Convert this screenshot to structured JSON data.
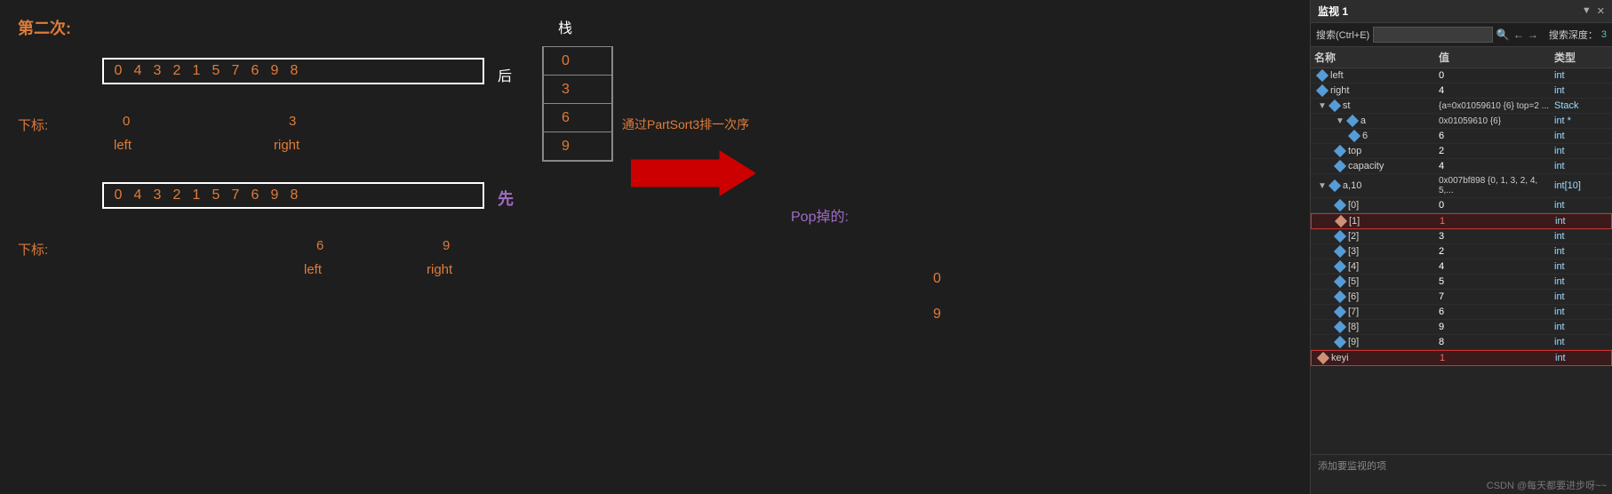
{
  "title": "第二次:",
  "main": {
    "second_label": "第二次:",
    "array_top": [
      "0",
      "4",
      "3",
      "2",
      "1",
      "5",
      "7",
      "6",
      "9",
      "8"
    ],
    "array_bottom": [
      "0",
      "4",
      "3",
      "2",
      "1",
      "5",
      "7",
      "6",
      "9",
      "8"
    ],
    "hou_label": "后",
    "xian_label": "先",
    "subscript_label1": "下标:",
    "subscript_label2": "下标:",
    "left_top_val": "0",
    "right_top_val": "3",
    "left_top_label": "left",
    "right_top_label": "right",
    "left_bottom_val": "6",
    "right_bottom_val": "9",
    "left_bottom_label": "left",
    "right_bottom_label": "right",
    "stack_label": "栈",
    "stack_values": [
      "0",
      "3",
      "6",
      "9"
    ],
    "annotation": "通过PartSort3排一次序",
    "pop_label": "Pop掉的:",
    "pop_values": [
      "0",
      "9"
    ],
    "watermark": "CSDN @每天都要进步呀~~"
  },
  "panel": {
    "title": "监视 1",
    "controls": [
      "▼",
      "＃"
    ],
    "search_placeholder": "搜索(Ctrl+E)",
    "depth_label": "搜索深度：",
    "depth_value": "3",
    "columns": [
      "名称",
      "值",
      "类型"
    ],
    "rows": [
      {
        "indent": 0,
        "name": "left",
        "value": "0",
        "type": "int",
        "highlighted": false,
        "expand": false
      },
      {
        "indent": 0,
        "name": "right",
        "value": "4",
        "type": "int",
        "highlighted": false,
        "expand": false
      },
      {
        "indent": 0,
        "name": "st",
        "value": "{a=0x01059610 {6} top=2 ...",
        "type": "Stack",
        "highlighted": false,
        "expand": true,
        "expanded": true
      },
      {
        "indent": 1,
        "name": "a",
        "value": "0x01059610 {6}",
        "type": "int *",
        "highlighted": false,
        "expand": true,
        "expanded": true
      },
      {
        "indent": 2,
        "name": "6",
        "value": "6",
        "type": "int",
        "highlighted": false,
        "expand": false
      },
      {
        "indent": 1,
        "name": "top",
        "value": "2",
        "type": "int",
        "highlighted": false,
        "expand": false
      },
      {
        "indent": 1,
        "name": "capacity",
        "value": "4",
        "type": "int",
        "highlighted": false,
        "expand": false
      },
      {
        "indent": 0,
        "name": "a,10",
        "value": "0x007bf898 {0, 1, 3, 2, 4, 5,...",
        "type": "int[10]",
        "highlighted": false,
        "expand": true,
        "expanded": true
      },
      {
        "indent": 1,
        "name": "[0]",
        "value": "0",
        "type": "int",
        "highlighted": false,
        "expand": false
      },
      {
        "indent": 1,
        "name": "[1]",
        "value": "1",
        "type": "int",
        "highlighted": true,
        "expand": false
      },
      {
        "indent": 1,
        "name": "[2]",
        "value": "3",
        "type": "int",
        "highlighted": false,
        "expand": false
      },
      {
        "indent": 1,
        "name": "[3]",
        "value": "2",
        "type": "int",
        "highlighted": false,
        "expand": false
      },
      {
        "indent": 1,
        "name": "[4]",
        "value": "4",
        "type": "int",
        "highlighted": false,
        "expand": false
      },
      {
        "indent": 1,
        "name": "[5]",
        "value": "5",
        "type": "int",
        "highlighted": false,
        "expand": false
      },
      {
        "indent": 1,
        "name": "[6]",
        "value": "7",
        "type": "int",
        "highlighted": false,
        "expand": false
      },
      {
        "indent": 1,
        "name": "[7]",
        "value": "6",
        "type": "int",
        "highlighted": false,
        "expand": false
      },
      {
        "indent": 1,
        "name": "[8]",
        "value": "9",
        "type": "int",
        "highlighted": false,
        "expand": false
      },
      {
        "indent": 1,
        "name": "[9]",
        "value": "8",
        "type": "int",
        "highlighted": false,
        "expand": false
      },
      {
        "indent": 0,
        "name": "keyi",
        "value": "1",
        "type": "int",
        "highlighted": true,
        "expand": false
      }
    ],
    "add_watch_label": "添加要监视的项"
  }
}
